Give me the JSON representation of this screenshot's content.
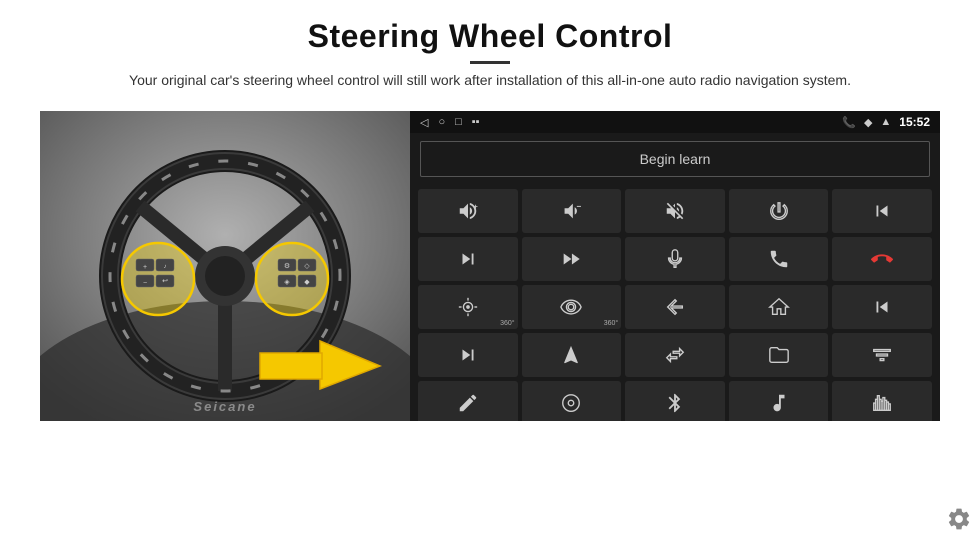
{
  "header": {
    "title": "Steering Wheel Control",
    "subtitle": "Your original car's steering wheel control will still work after installation of this all-in-one auto radio navigation system."
  },
  "panel": {
    "begin_learn_label": "Begin learn",
    "status_time": "15:52"
  },
  "icons": [
    {
      "name": "vol-up",
      "symbol": "🔊+"
    },
    {
      "name": "vol-down",
      "symbol": "🔊-"
    },
    {
      "name": "vol-mute",
      "symbol": "🔇"
    },
    {
      "name": "power",
      "symbol": "⏻"
    },
    {
      "name": "prev-track",
      "symbol": "⏮"
    },
    {
      "name": "next",
      "symbol": "⏭"
    },
    {
      "name": "fast-forward",
      "symbol": "⏭"
    },
    {
      "name": "mic",
      "symbol": "🎤"
    },
    {
      "name": "phone",
      "symbol": "📞"
    },
    {
      "name": "hang-up",
      "symbol": "📵"
    },
    {
      "name": "flashlight",
      "symbol": "🔦"
    },
    {
      "name": "360",
      "symbol": "👁"
    },
    {
      "name": "back",
      "symbol": "↩"
    },
    {
      "name": "home",
      "symbol": "🏠"
    },
    {
      "name": "skip-back",
      "symbol": "⏮"
    },
    {
      "name": "skip-forward",
      "symbol": "⏭"
    },
    {
      "name": "navigate",
      "symbol": "◀"
    },
    {
      "name": "swap",
      "symbol": "⇄"
    },
    {
      "name": "folder",
      "symbol": "📁"
    },
    {
      "name": "equalizer",
      "symbol": "🎚"
    },
    {
      "name": "pen",
      "symbol": "✏"
    },
    {
      "name": "settings-circle",
      "symbol": "⚙"
    },
    {
      "name": "bluetooth",
      "symbol": "🎵"
    },
    {
      "name": "music",
      "symbol": "🎵"
    },
    {
      "name": "waveform",
      "symbol": "📊"
    }
  ]
}
